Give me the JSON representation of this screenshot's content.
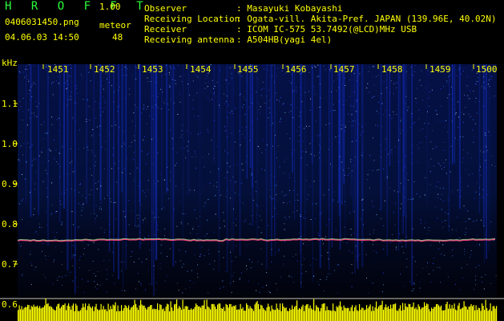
{
  "header": {
    "app_title": "H R O F F T",
    "app_version": "1.00",
    "file_name": "0406031450.png",
    "meteor_label": "meteor",
    "datetime": "04.06.03 14:50",
    "meteor_count": "48",
    "info": [
      {
        "key": "Observer",
        "value": ": Masayuki Kobayashi"
      },
      {
        "key": "Receiving Location",
        "value": ": Ogata-vill. Akita-Pref. JAPAN (139.96E, 40.02N)"
      },
      {
        "key": "Receiver",
        "value": ": ICOM IC-575 53.7492(@LCD)MHz USB"
      },
      {
        "key": "Receiving antenna",
        "value": ": A504HB(yagi 4el)"
      }
    ]
  },
  "spectrogram": {
    "y_unit": "kHz",
    "y_ticks": [
      "1.1",
      "1.0",
      "0.9",
      "0.8",
      "0.7",
      "0.6"
    ],
    "time_labels": [
      "1451",
      "1452",
      "1453",
      "1454",
      "1455",
      "1456",
      "1457",
      "1458",
      "1459",
      "1500"
    ],
    "colors": {
      "background": "#000000",
      "noise": "#1a3cff",
      "carrier": "#ff4080",
      "signal_bar": "#ffff00",
      "label": "#ffff00"
    }
  }
}
